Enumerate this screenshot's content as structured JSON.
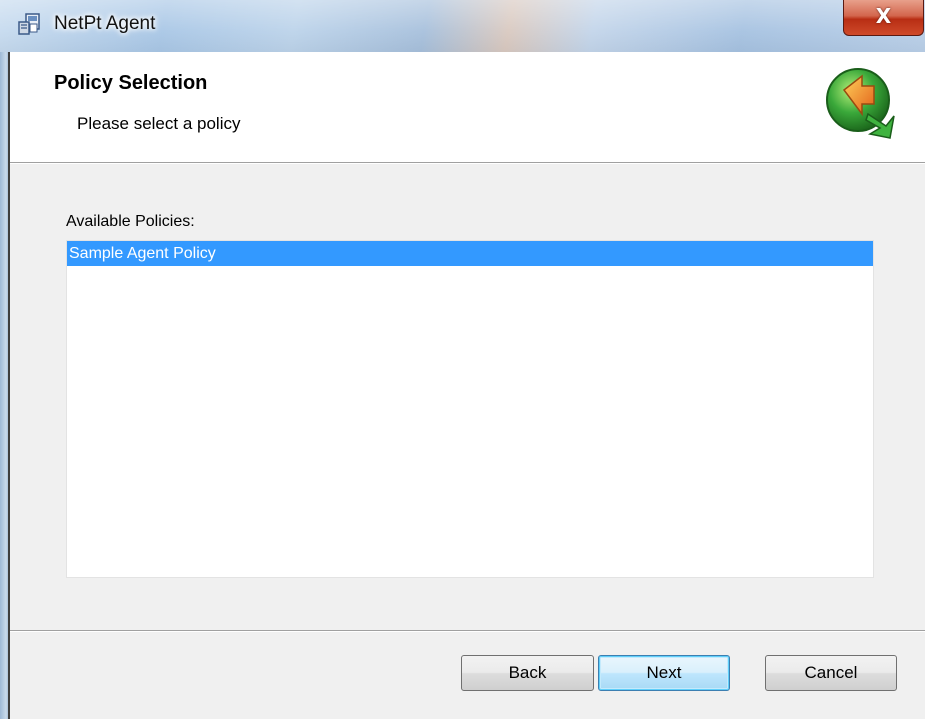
{
  "window": {
    "title": "NetPt Agent",
    "close_glyph": "X",
    "icon": "installer-icon"
  },
  "header": {
    "title": "Policy Selection",
    "subtitle": "Please select a policy",
    "logo_icon": "green-refresh-arrow-logo"
  },
  "policies": {
    "label": "Available Policies:",
    "items": [
      {
        "label": "Sample Agent Policy",
        "selected": true
      }
    ]
  },
  "buttons": {
    "back": "Back",
    "next": "Next",
    "cancel": "Cancel"
  },
  "colors": {
    "selection": "#3399ff",
    "close_button": "#c7432a",
    "logo_green": "#3aa83a",
    "logo_orange": "#f28a1e"
  }
}
